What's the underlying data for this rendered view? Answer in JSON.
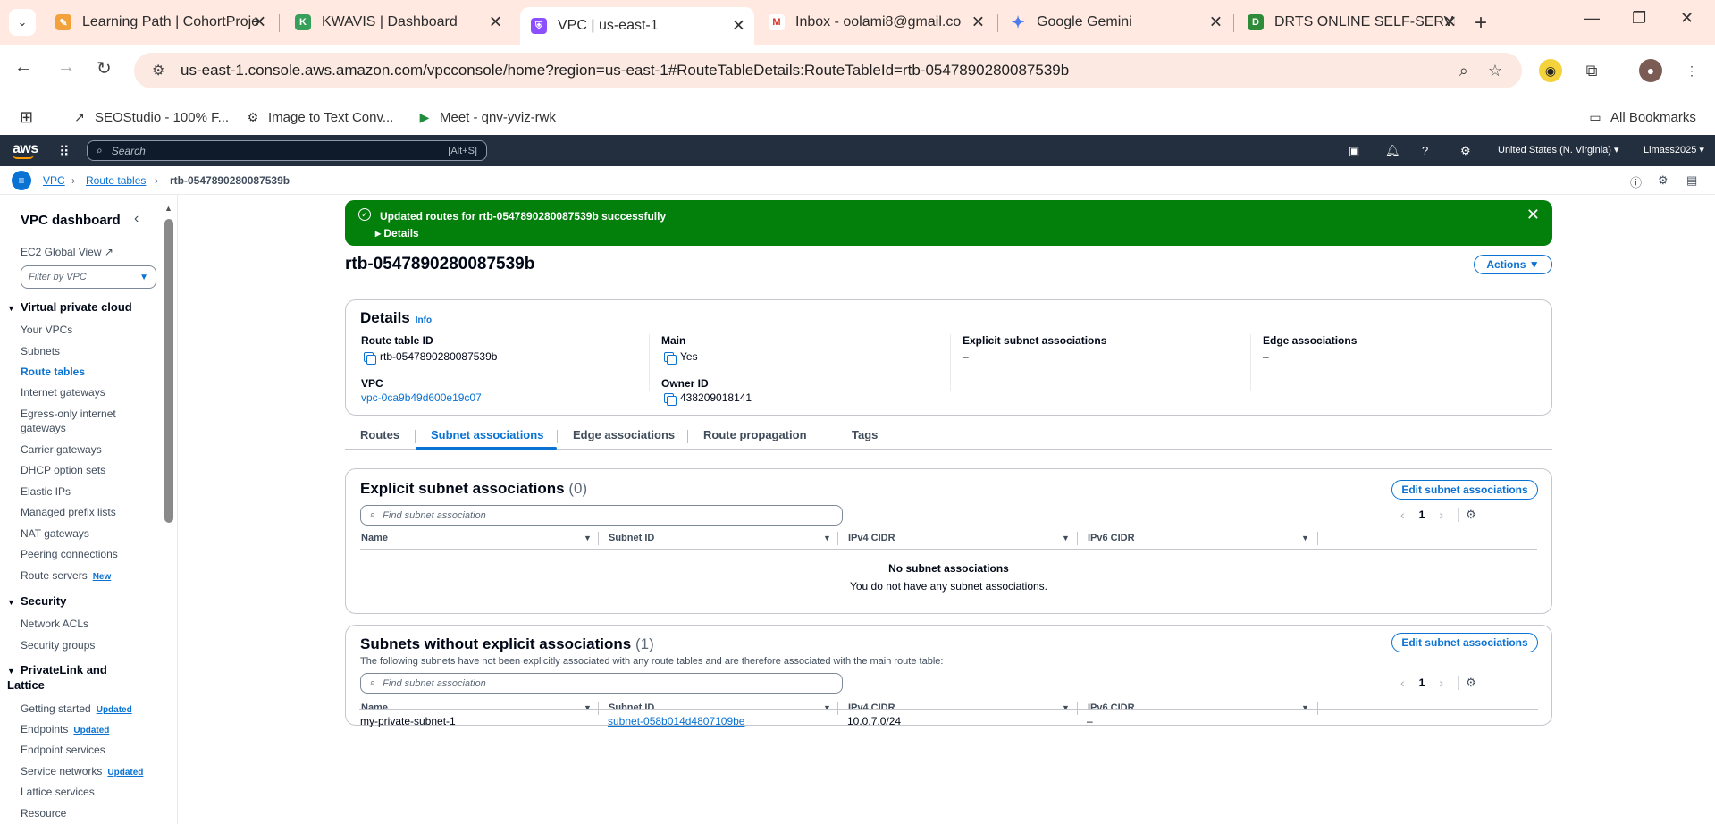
{
  "browser": {
    "tabs": [
      {
        "title": "Learning Path | CohortProje",
        "favicon": "cohort-icon"
      },
      {
        "title": "KWAVIS | Dashboard",
        "favicon": "kwavis-icon"
      },
      {
        "title": "VPC | us-east-1",
        "favicon": "vpc-icon"
      },
      {
        "title": "Inbox - oolami8@gmail.co",
        "favicon": "gmail-icon"
      },
      {
        "title": "Google Gemini",
        "favicon": "gemini-icon"
      },
      {
        "title": "DRTS ONLINE SELF-SERVIC",
        "favicon": "drts-icon"
      }
    ],
    "url": "us-east-1.console.aws.amazon.com/vpcconsole/home?region=us-east-1#RouteTableDetails:RouteTableId=rtb-0547890280087539b",
    "bookmarks": [
      "SEOStudio - 100% F...",
      "Image to Text Conv...",
      "Meet - qnv-yviz-rwk"
    ],
    "all_bookmarks": "All Bookmarks"
  },
  "aws": {
    "logo": "aws",
    "search_placeholder": "Search",
    "search_shortcut": "[Alt+S]",
    "region": "United States (N. Virginia) ▾",
    "account": "Limass2025 ▾",
    "colors": {
      "top_nav": "#232f3e",
      "accent": "#0972d3",
      "success": "#037f0c"
    }
  },
  "breadcrumb": {
    "items": [
      "VPC",
      "Route tables",
      "rtb-0547890280087539b"
    ]
  },
  "sidebar": {
    "title": "VPC dashboard",
    "ec2_global_view": "EC2 Global View",
    "filter_placeholder": "Filter by VPC",
    "sections": [
      {
        "title": "Virtual private cloud",
        "items": [
          "Your VPCs",
          "Subnets",
          "Route tables",
          "Internet gateways",
          "Egress-only internet gateways",
          "Carrier gateways",
          "DHCP option sets",
          "Elastic IPs",
          "Managed prefix lists",
          "NAT gateways",
          "Peering connections",
          "Route servers"
        ]
      },
      {
        "title": "Security",
        "items": [
          "Network ACLs",
          "Security groups"
        ]
      },
      {
        "title": "PrivateLink and Lattice",
        "items": [
          "Getting started",
          "Endpoints",
          "Endpoint services",
          "Service networks",
          "Lattice services",
          "Resource"
        ]
      }
    ],
    "badges": {
      "new": "New",
      "updated": "Updated"
    }
  },
  "flash": {
    "message": "Updated routes for rtb-0547890280087539b successfully",
    "details": "Details"
  },
  "page": {
    "title": "rtb-0547890280087539b",
    "actions_label": "Actions ▼"
  },
  "details": {
    "heading": "Details",
    "info": "Info",
    "route_table_id_label": "Route table ID",
    "route_table_id": "rtb-0547890280087539b",
    "main_label": "Main",
    "main": "Yes",
    "explicit_label": "Explicit subnet associations",
    "explicit": "–",
    "edge_label": "Edge associations",
    "edge": "–",
    "vpc_label": "VPC",
    "vpc": "vpc-0ca9b49d600e19c07",
    "owner_label": "Owner ID",
    "owner": "438209018141"
  },
  "tabs": [
    "Routes",
    "Subnet associations",
    "Edge associations",
    "Route propagation",
    "Tags"
  ],
  "explicit_assoc": {
    "heading": "Explicit subnet associations",
    "count": "(0)",
    "edit_label": "Edit subnet associations",
    "search_placeholder": "Find subnet association",
    "page": "1",
    "columns": [
      "Name",
      "Subnet ID",
      "IPv4 CIDR",
      "IPv6 CIDR"
    ],
    "empty_title": "No subnet associations",
    "empty_sub": "You do not have any subnet associations."
  },
  "implicit_assoc": {
    "heading": "Subnets without explicit associations",
    "count": "(1)",
    "description": "The following subnets have not been explicitly associated with any route tables and are therefore associated with the main route table:",
    "edit_label": "Edit subnet associations",
    "search_placeholder": "Find subnet association",
    "page": "1",
    "columns": [
      "Name",
      "Subnet ID",
      "IPv4 CIDR",
      "IPv6 CIDR"
    ],
    "rows": [
      {
        "name": "my-private-subnet-1",
        "subnet_id": "subnet-058b014d4807109be",
        "ipv4": "10.0.7.0/24",
        "ipv6": "–"
      }
    ]
  }
}
